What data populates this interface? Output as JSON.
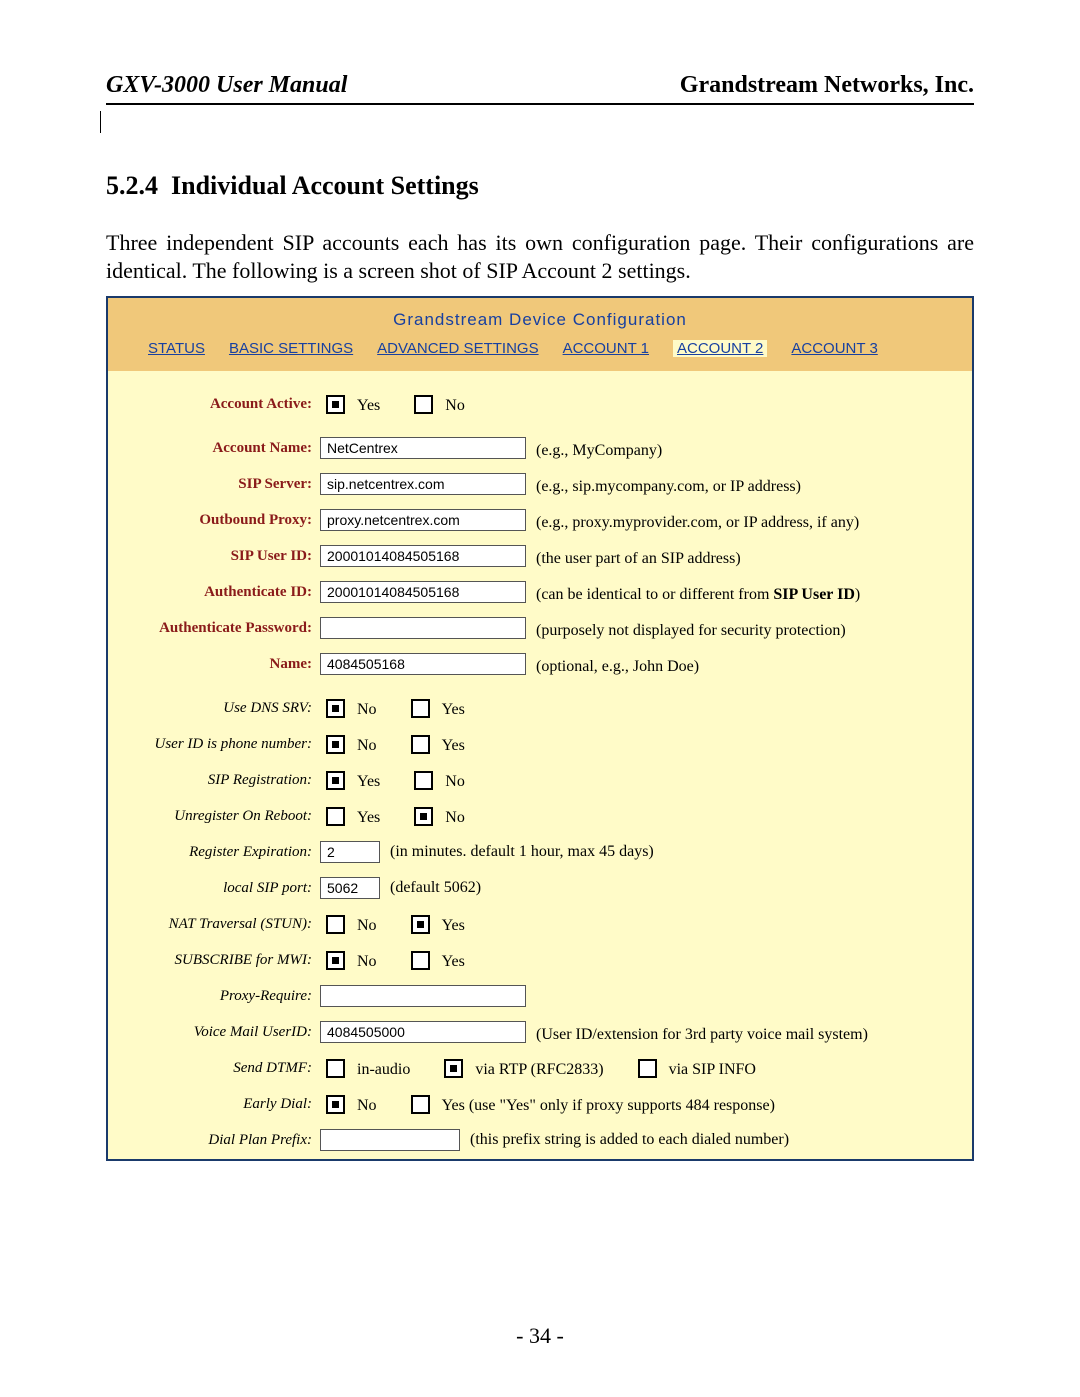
{
  "header": {
    "left": "GXV-3000 User Manual",
    "right": "Grandstream Networks, Inc."
  },
  "section": {
    "number": "5.2.4",
    "title": "Individual Account Settings"
  },
  "intro": "Three independent SIP accounts each has its own configuration page.  Their configurations are identical. The following is a screen shot of SIP Account 2 settings.",
  "cfg": {
    "title": "Grandstream Device Configuration",
    "tabs": [
      "STATUS",
      "BASIC SETTINGS",
      "ADVANCED SETTINGS",
      "ACCOUNT 1",
      "ACCOUNT 2",
      "ACCOUNT 3"
    ],
    "activeTab": 4
  },
  "f": {
    "accountActive": {
      "label": "Account Active:",
      "opts": [
        "Yes",
        "No"
      ],
      "sel": 0
    },
    "accountName": {
      "label": "Account Name:",
      "value": "NetCentrex",
      "hint": "(e.g., MyCompany)"
    },
    "sipServer": {
      "label": "SIP Server:",
      "value": "sip.netcentrex.com",
      "hint": "(e.g., sip.mycompany.com, or IP address)"
    },
    "outboundProxy": {
      "label": "Outbound Proxy:",
      "value": "proxy.netcentrex.com",
      "hint": "(e.g., proxy.myprovider.com, or IP address, if any)"
    },
    "sipUserId": {
      "label": "SIP User ID:",
      "value": "20001014084505168",
      "hint": "(the user part of an SIP address)"
    },
    "authId": {
      "label": "Authenticate ID:",
      "value": "20001014084505168",
      "hint_pre": "(can be identical to or different from ",
      "hint_bold": "SIP User ID",
      "hint_post": ")"
    },
    "authPwd": {
      "label": "Authenticate Password:",
      "value": "",
      "hint": "(purposely not displayed for security protection)"
    },
    "name": {
      "label": "Name:",
      "value": "4084505168",
      "hint": "(optional, e.g., John Doe)"
    },
    "dnsSrv": {
      "label": "Use DNS SRV:",
      "opts": [
        "No",
        "Yes"
      ],
      "sel": 0
    },
    "uidPhone": {
      "label": "User ID is phone number:",
      "opts": [
        "No",
        "Yes"
      ],
      "sel": 0
    },
    "sipReg": {
      "label": "SIP Registration:",
      "opts": [
        "Yes",
        "No"
      ],
      "sel": 0
    },
    "unregReboot": {
      "label": "Unregister On Reboot:",
      "opts": [
        "Yes",
        "No"
      ],
      "sel": 1
    },
    "regExp": {
      "label": "Register Expiration:",
      "value": "2",
      "hint": "(in minutes. default 1 hour, max 45 days)"
    },
    "localPort": {
      "label": "local SIP port:",
      "value": "5062",
      "hint": "(default 5062)"
    },
    "natStun": {
      "label": "NAT Traversal (STUN):",
      "opts": [
        "No",
        "Yes"
      ],
      "sel": 1
    },
    "subMwi": {
      "label": "SUBSCRIBE for MWI:",
      "opts": [
        "No",
        "Yes"
      ],
      "sel": 0
    },
    "proxyReq": {
      "label": "Proxy-Require:",
      "value": ""
    },
    "vmUid": {
      "label": "Voice Mail UserID:",
      "value": "4084505000",
      "hint": "(User ID/extension for 3rd party voice mail system)"
    },
    "dtmf": {
      "label": "Send DTMF:",
      "opts": [
        "in-audio",
        "via RTP (RFC2833)",
        "via SIP INFO"
      ],
      "sel": 1
    },
    "earlyDial": {
      "label": "Early Dial:",
      "opts": [
        "No",
        "Yes (use \"Yes\" only if proxy supports 484 response)"
      ],
      "sel": 0
    },
    "dialPlan": {
      "label": "Dial Plan Prefix:",
      "value": "",
      "hint": "(this prefix string is added to each dialed number)"
    }
  },
  "pageNum": "- 34 -"
}
